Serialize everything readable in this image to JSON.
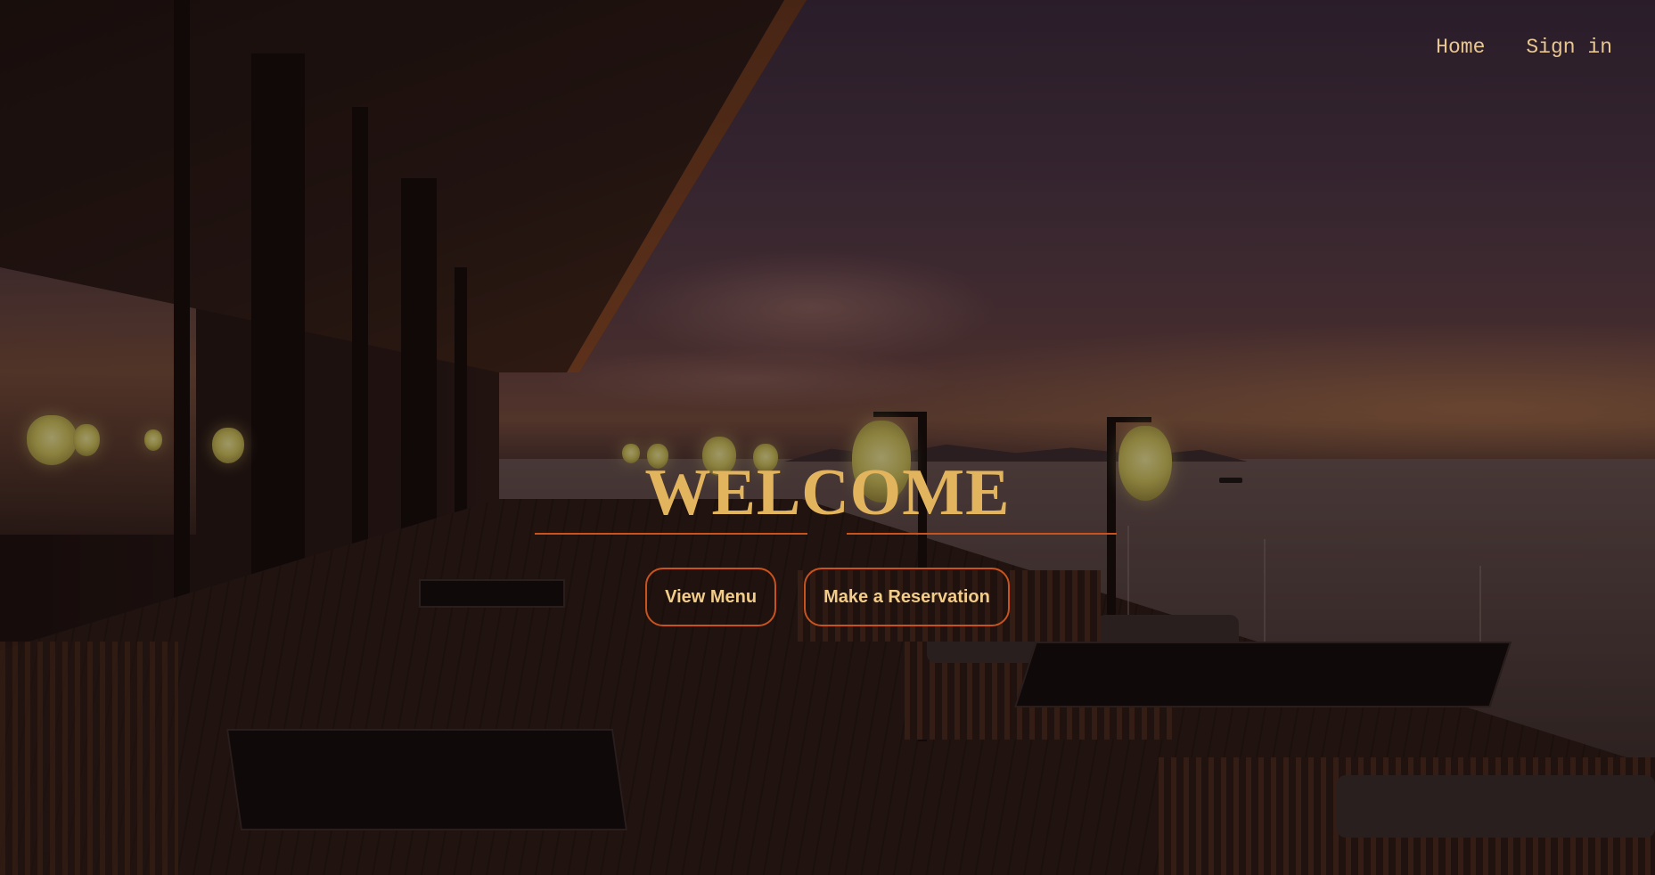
{
  "nav": {
    "items": [
      {
        "label": "Home"
      },
      {
        "label": "Sign in"
      }
    ]
  },
  "hero": {
    "title": "WELCOME",
    "buttons": [
      {
        "label": "View Menu"
      },
      {
        "label": "Make a Reservation"
      }
    ],
    "background_icon": "restaurant-terrace-sunset-photo"
  },
  "colors": {
    "accent_gold": "#e3b45e",
    "accent_orange": "#c9531c",
    "nav_text": "#e8c790",
    "button_text": "#f2cd8a"
  }
}
